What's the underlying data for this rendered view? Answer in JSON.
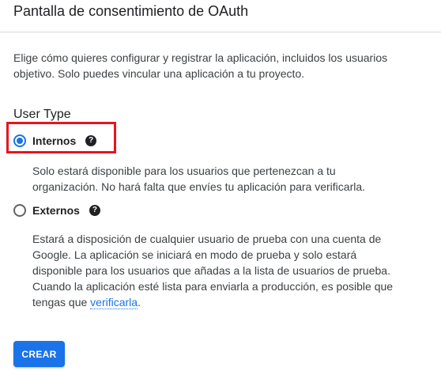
{
  "header": {
    "title": "Pantalla de consentimiento de OAuth"
  },
  "intro": {
    "line1": "Elige cómo quieres configurar y registrar la aplicación, incluidos los usuarios",
    "line2": "objetivo. Solo puedes vincular una aplicación a tu proyecto."
  },
  "user_type": {
    "title": "User Type",
    "options": [
      {
        "label": "Internos",
        "selected": true,
        "help_icon": "help-icon",
        "description": [
          "Solo estará disponible para los usuarios que pertenezcan a tu",
          "organización. No hará falta que envíes tu aplicación para verificarla."
        ]
      },
      {
        "label": "Externos",
        "selected": false,
        "help_icon": "help-icon",
        "description": [
          "Estará a disposición de cualquier usuario de prueba con una cuenta de",
          "Google. La aplicación se iniciará en modo de prueba y solo estará",
          "disponible para los usuarios que añadas a la lista de usuarios de prueba.",
          "Cuando la aplicación esté lista para enviarla a producción, es posible que"
        ],
        "description_last_prefix": "tengas que ",
        "description_link": "verificarla",
        "description_last_suffix": "."
      }
    ]
  },
  "actions": {
    "create_label": "CREAR"
  },
  "colors": {
    "accent": "#1a73e8",
    "highlight": "#e8141e"
  }
}
